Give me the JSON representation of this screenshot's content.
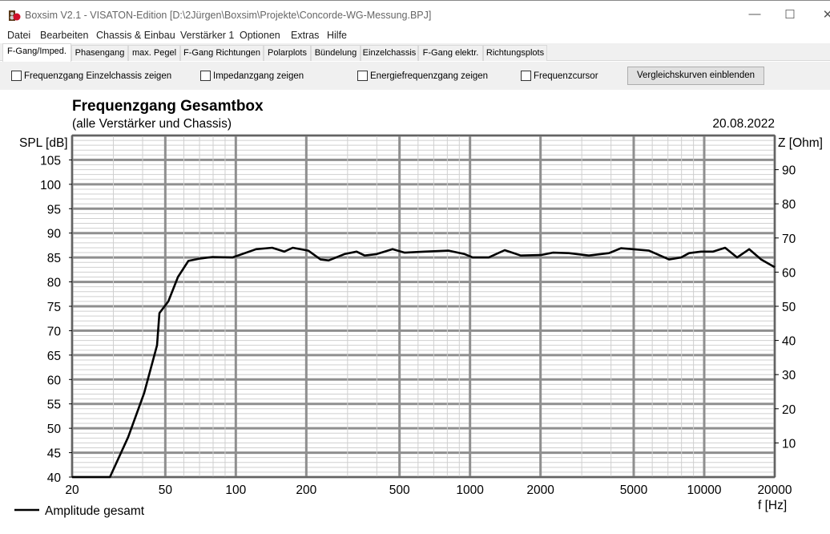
{
  "window": {
    "title": "Boxsim V2.1 - VISATON-Edition [D:\\2Jürgen\\Boxsim\\Projekte\\Concorde-WG-Messung.BPJ]",
    "minimize": "—",
    "maximize": "☐",
    "close": "✕"
  },
  "menu": [
    "Datei",
    "Bearbeiten",
    "Chassis & Einbau",
    "Verstärker 1",
    "Optionen",
    "Extras",
    "Hilfe"
  ],
  "tabs": [
    {
      "label": "F-Gang/Imped.",
      "active": true
    },
    {
      "label": "Phasengang"
    },
    {
      "label": "max. Pegel"
    },
    {
      "label": "F-Gang Richtungen"
    },
    {
      "label": "Polarplots"
    },
    {
      "label": "Bündelung"
    },
    {
      "label": "Einzelchassis"
    },
    {
      "label": "F-Gang elektr."
    },
    {
      "label": "Richtungsplots"
    }
  ],
  "options": {
    "checkboxes": [
      {
        "label": "Frequenzgang Einzelchassis zeigen",
        "checked": false
      },
      {
        "label": "Impedanzgang zeigen",
        "checked": false
      },
      {
        "label": "Energiefrequenzgang zeigen",
        "checked": false
      },
      {
        "label": "Frequenzcursor",
        "checked": false
      }
    ],
    "button": "Vergleichskurven einblenden"
  },
  "chart_data": {
    "type": "line",
    "title": "Frequenzgang Gesamtbox",
    "subtitle": "(alle Verstärker und Chassis)",
    "date": "20.08.2022",
    "ylabel": "SPL [dB]",
    "y2label": "Z [Ohm]",
    "xlabel": "f [Hz]",
    "xscale": "log",
    "xlim": [
      20,
      20000
    ],
    "ylim": [
      40,
      110
    ],
    "y2lim": [
      0,
      100
    ],
    "xticks": [
      20,
      50,
      100,
      200,
      500,
      1000,
      2000,
      5000,
      10000,
      20000
    ],
    "yticks": [
      40,
      45,
      50,
      55,
      60,
      65,
      70,
      75,
      80,
      85,
      90,
      95,
      100,
      105
    ],
    "y2ticks": [
      10,
      20,
      30,
      40,
      50,
      60,
      70,
      80,
      90
    ],
    "grid": true,
    "legend": "bottom-left",
    "series": [
      {
        "name": "Amplitude gesamt",
        "color": "#000000",
        "x": [
          20,
          29,
          34.7,
          40.6,
          46.1,
          47.2,
          51.5,
          56.6,
          62.7,
          70.5,
          79.4,
          96.7,
          122,
          143,
          161,
          175,
          204,
          230,
          249,
          291,
          328,
          355,
          399,
          467,
          526,
          640,
          811,
          949,
          1027,
          1202,
          1407,
          1647,
          2006,
          2257,
          2643,
          3218,
          3920,
          4410,
          4966,
          5809,
          7077,
          7962,
          8614,
          9695,
          10916,
          12285,
          13827,
          15560,
          17514,
          20000
        ],
        "y": [
          40,
          40,
          48.2,
          57.2,
          67,
          73.6,
          76,
          81,
          84.3,
          84.8,
          85.1,
          85,
          86.7,
          87,
          86.2,
          87,
          86.4,
          84.6,
          84.4,
          85.7,
          86.2,
          85.4,
          85.7,
          86.7,
          86,
          86.2,
          86.4,
          85.7,
          85,
          85,
          86.5,
          85.4,
          85.5,
          86,
          85.9,
          85.4,
          85.9,
          86.9,
          86.7,
          86.4,
          84.6,
          85,
          85.9,
          86.2,
          86.2,
          87,
          85,
          86.7,
          84.6,
          83
        ]
      }
    ]
  }
}
